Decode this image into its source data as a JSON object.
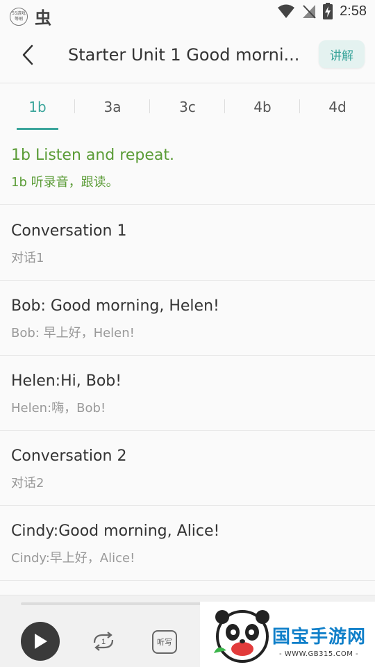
{
  "status_bar": {
    "badge_text": "55游戏 等刷",
    "time": "2:58"
  },
  "header": {
    "title": "Starter Unit 1 Good morni...",
    "explain_label": "讲解"
  },
  "tabs": [
    {
      "label": "1b",
      "active": true
    },
    {
      "label": "3a",
      "active": false
    },
    {
      "label": "3c",
      "active": false
    },
    {
      "label": "4b",
      "active": false
    },
    {
      "label": "4d",
      "active": false
    }
  ],
  "section": {
    "title_en": "1b Listen and repeat.",
    "title_cn": "1b 听录音，跟读。"
  },
  "items": [
    {
      "en": "Conversation 1",
      "cn": "对话1"
    },
    {
      "en": "Bob: Good morning, Helen!",
      "cn": "Bob: 早上好，Helen!"
    },
    {
      "en": "Helen:Hi, Bob!",
      "cn": "Helen:嗨，Bob!"
    },
    {
      "en": "Conversation 2",
      "cn": "对话2"
    },
    {
      "en": "Cindy:Good morning, Alice!",
      "cn": "Cindy:早上好，Alice!"
    }
  ],
  "player": {
    "repeat_count": "1",
    "dictation_label": "听写"
  },
  "watermark": {
    "logo_text": "国宝手游网",
    "url": "- WWW.GB315.COM -"
  },
  "colors": {
    "accent": "#3ba59b",
    "section_green": "#5b9c37",
    "brand_blue": "#0f7fc9"
  }
}
